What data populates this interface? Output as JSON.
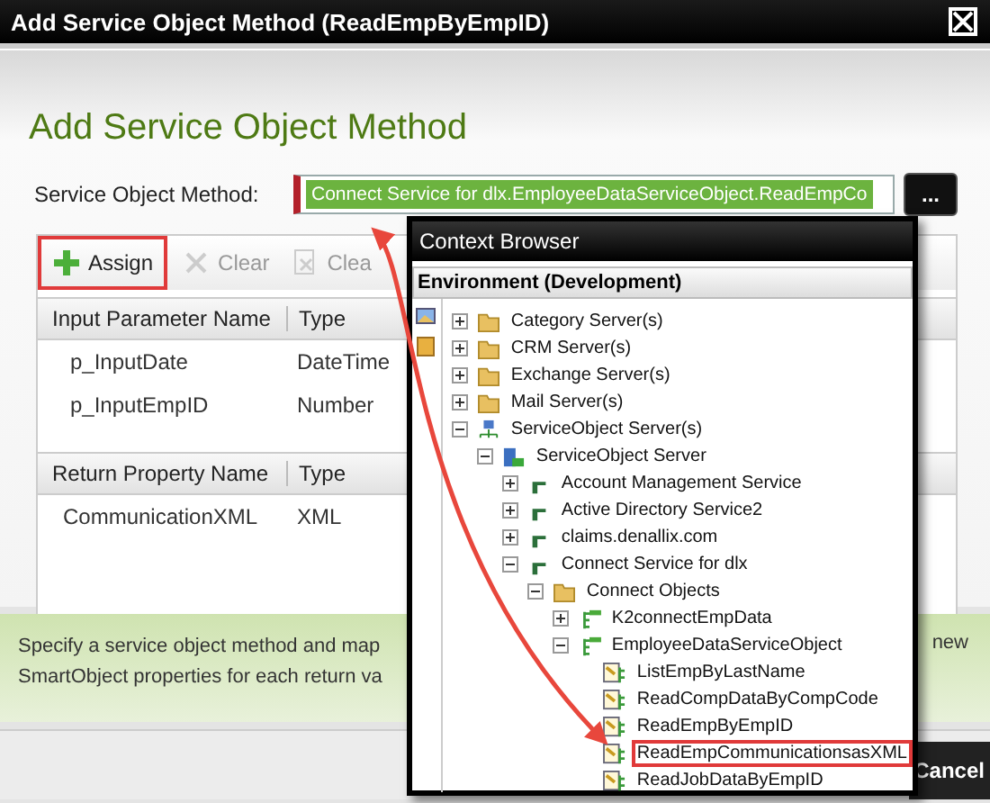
{
  "window": {
    "title": "Add Service Object Method (ReadEmpByEmpID)"
  },
  "heading": "Add Service Object Method",
  "method_field": {
    "label": "Service Object Method:",
    "value": "Connect Service for dlx.EmployeeDataServiceObject.ReadEmpCo",
    "browse_button": "..."
  },
  "toolbar": [
    {
      "label": "Assign",
      "kind": "add",
      "disabled": false,
      "highlighted": true
    },
    {
      "label": "Clear",
      "kind": "clear",
      "disabled": true,
      "highlighted": false
    },
    {
      "label": "Clea",
      "kind": "clear-all",
      "disabled": true,
      "highlighted": false
    }
  ],
  "input_table": {
    "columns": [
      "Input Parameter Name",
      "Type"
    ],
    "rows": [
      [
        "p_InputDate",
        "DateTime"
      ],
      [
        "p_InputEmpID",
        "Number"
      ]
    ]
  },
  "return_table": {
    "columns": [
      "Return Property Name",
      "Type"
    ],
    "rows": [
      [
        "CommunicationXML",
        "XML"
      ]
    ]
  },
  "info": {
    "lines": [
      "Specify a service object method and map",
      "SmartObject properties for each return va"
    ],
    "right_text": "new"
  },
  "context_browser": {
    "title": "Context Browser",
    "environment": "Environment (Development)",
    "tree": [
      {
        "label": "Category Server(s)",
        "kind": "folder",
        "expanded": false,
        "highlighted": false
      },
      {
        "label": "CRM Server(s)",
        "kind": "folder",
        "expanded": false,
        "highlighted": false
      },
      {
        "label": "Exchange Server(s)",
        "kind": "folder",
        "expanded": false,
        "highlighted": false
      },
      {
        "label": "Mail Server(s)",
        "kind": "folder",
        "expanded": false,
        "highlighted": false
      },
      {
        "label": "ServiceObject Server(s)",
        "kind": "network",
        "expanded": true,
        "highlighted": false,
        "children": [
          {
            "label": "ServiceObject Server",
            "kind": "server",
            "expanded": true,
            "highlighted": false,
            "children": [
              {
                "label": "Account Management Service",
                "kind": "service",
                "expanded": false,
                "highlighted": false
              },
              {
                "label": "Active Directory Service2",
                "kind": "service",
                "expanded": false,
                "highlighted": false
              },
              {
                "label": "claims.denallix.com",
                "kind": "service",
                "expanded": false,
                "highlighted": false
              },
              {
                "label": "Connect Service for dlx",
                "kind": "service",
                "expanded": true,
                "highlighted": false,
                "children": [
                  {
                    "label": "Connect Objects",
                    "kind": "folder",
                    "expanded": true,
                    "highlighted": false,
                    "children": [
                      {
                        "label": "K2connectEmpData",
                        "kind": "object",
                        "expanded": false,
                        "highlighted": false
                      },
                      {
                        "label": "EmployeeDataServiceObject",
                        "kind": "object",
                        "expanded": true,
                        "highlighted": false,
                        "children": [
                          {
                            "label": "ListEmpByLastName",
                            "kind": "method",
                            "highlighted": false
                          },
                          {
                            "label": "ReadCompDataByCompCode",
                            "kind": "method",
                            "highlighted": false
                          },
                          {
                            "label": "ReadEmpByEmpID",
                            "kind": "method",
                            "highlighted": false
                          },
                          {
                            "label": "ReadEmpCommunicationsasXML",
                            "kind": "method",
                            "highlighted": true
                          },
                          {
                            "label": "ReadJobDataByEmpID",
                            "kind": "method",
                            "highlighted": false
                          }
                        ]
                      }
                    ]
                  }
                ]
              }
            ]
          }
        ]
      }
    ]
  },
  "buttons": [
    {
      "label": "Cancel"
    }
  ]
}
